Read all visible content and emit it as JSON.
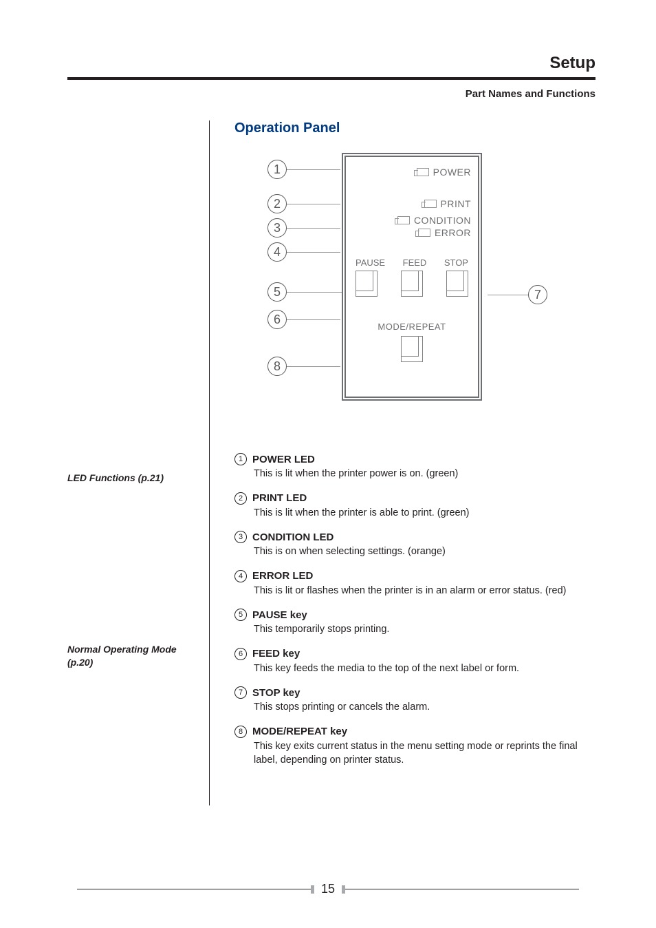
{
  "chapter_title": "Setup",
  "subsection": "Part Names and Functions",
  "section_heading": "Operation Panel",
  "margin_notes": {
    "led_ref": "LED Functions (p.21)",
    "mode_ref_line1": "Normal Operating Mode",
    "mode_ref_line2": "(p.20)"
  },
  "diagram": {
    "callouts_left": [
      "1",
      "2",
      "3",
      "4",
      "5",
      "6",
      "8"
    ],
    "callout_right": "7",
    "panel_labels": {
      "power": "POWER",
      "print": "PRINT",
      "condition": "CONDITION",
      "error": "ERROR",
      "pause": "PAUSE",
      "feed": "FEED",
      "stop": "STOP",
      "mode_repeat": "MODE/REPEAT"
    }
  },
  "items": [
    {
      "num": "1",
      "title": "POWER LED",
      "desc": "This is lit when the printer power is on. (green)"
    },
    {
      "num": "2",
      "title": "PRINT LED",
      "desc": "This is lit when the printer is able to print. (green)"
    },
    {
      "num": "3",
      "title": "CONDITION LED",
      "desc": "This is on when selecting settings. (orange)"
    },
    {
      "num": "4",
      "title": "ERROR LED",
      "desc": "This is lit or flashes when the printer is in an alarm or error status. (red)"
    },
    {
      "num": "5",
      "title": "PAUSE key",
      "desc": "This temporarily stops printing."
    },
    {
      "num": "6",
      "title": "FEED key",
      "desc": "This key feeds the media to the top of the next label or form."
    },
    {
      "num": "7",
      "title": "STOP key",
      "desc": "This stops printing or cancels the alarm."
    },
    {
      "num": "8",
      "title": "MODE/REPEAT key",
      "desc": "This key exits current status in the menu setting mode or reprints the final label, depending on printer status."
    }
  ],
  "page_number": "15"
}
